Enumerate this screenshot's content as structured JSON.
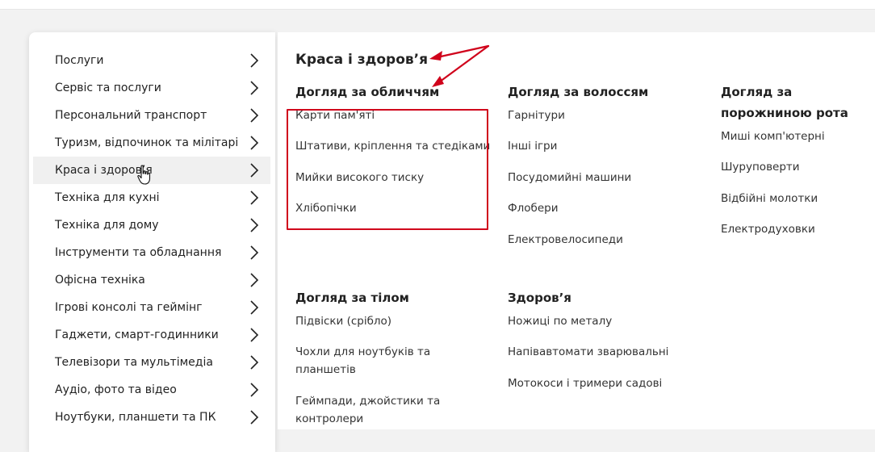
{
  "sidebar": {
    "items": [
      {
        "label": "Послуги"
      },
      {
        "label": "Сервіс та послуги"
      },
      {
        "label": "Персональний транспорт"
      },
      {
        "label": "Туризм, відпочинок та мілітарі"
      },
      {
        "label": "Краса і здоров’я",
        "active": true
      },
      {
        "label": "Техніка для кухні"
      },
      {
        "label": "Техніка для дому"
      },
      {
        "label": "Інструменти та обладнання"
      },
      {
        "label": "Офісна техніка"
      },
      {
        "label": "Ігрові консолі та геймінг"
      },
      {
        "label": "Гаджети, смарт-годинники"
      },
      {
        "label": "Телевізори та мультімедіа"
      },
      {
        "label": "Аудіо, фото та відео"
      },
      {
        "label": "Ноутбуки, планшети та ПК"
      }
    ]
  },
  "panel": {
    "title": "Краса і здоров’я",
    "groups": [
      {
        "title": "Догляд за обличчям",
        "items": [
          "Карти пам'яті",
          "Штативи, кріплення та стедіками",
          "Мийки високого тиску",
          "Хлібопічки"
        ]
      },
      {
        "title": "Догляд за волоссям",
        "items": [
          "Гарнітури",
          "Інші ігри",
          "Посудомийні машини",
          "Флобери",
          "Електровелосипеди"
        ]
      },
      {
        "title": "Догляд за порожниною рота",
        "items": [
          "Миші комп'ютерні",
          "Шуруповерти",
          "Відбійні молотки",
          "Електродуховки"
        ]
      },
      {
        "title": "Догляд за тілом",
        "items": [
          "Підвіски (срібло)",
          "Чохли для ноутбуків та планшетів",
          "Геймпади, джойстики та контролери"
        ]
      },
      {
        "title": "Здоров’я",
        "items": [
          "Ножиці по металу",
          "Напівавтомати зварювальні",
          "Мотокоси і тримери садові"
        ]
      }
    ]
  },
  "icons": {
    "chevron": "chevron-right-icon",
    "cursor": "hand-pointer-icon"
  },
  "colors": {
    "annotation": "#d0021b",
    "text": "#222222",
    "active_row": "#f0f0f0"
  }
}
